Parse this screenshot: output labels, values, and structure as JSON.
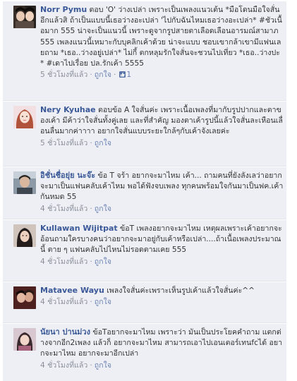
{
  "comments": [
    {
      "name": "Norr Pymu",
      "text": "ตอบ 'O' ว่างเปล่า เพราะเป็นเพลงแนวเต้น *มือโดนมือใจสั่นอีกแล้วสิ ถ้าเป็นแบบนี้เธอว่างอะเปล่า 'ไปกับฉันไหมเธอว่างอะเปล่า* #ชัวเนื้อมาก 555 น่าจะเป็นแนวนี้ เพราะดูจากรูปสายตาเลือดเลือนอารมณ์สามาภ 555 เพลงแนวนี้เหมาะกับบุคลิกเค้าด้วย น่าจะแบบ ชอบเขากล้าเขามีแฟนเลยถาม *เธอ..ว่างอยู่เปล่า* ไม่กี้ ตกหลุมรักใจสั่นจะชวนไปเที่ยว *เธอ..ว่างปะ* #เดาไปเรื่อย ปล.รักเค้า 5555",
      "time": "5 ชั่วโมงที่แล้ว",
      "like": "ถูกใจ",
      "like_count": "1",
      "avatar": "avatar-woman-1"
    },
    {
      "name": "Nery Kyuhae",
      "text": "ตอบข้อ A ใจสั่นค่ะ เพราะเนื้อเพลงที่มากับรูปปากและตาของเค้า มีค้าว่าใจสั่นทั้งคู่เลย และที่สำคัญ มองตาเค้ารูปนี้แล้วใจสั่นละเหือนเลื่อนลื่นมากค่าาาา อยากใจสั่นแบบระยะใกล้ๆกับเค้าจังเลยค่ะ",
      "time": "5 ชั่วโมงที่แล้ว",
      "like": "ถูกใจ",
      "avatar": "avatar-woman-2"
    },
    {
      "name": "อิชั่นชื่อยุ่ย นะจ๊ะ",
      "text": "ข้อ T จร้า อยากจะมาไหม เค้า... ถามคนที่ยังลังเลว่าอยากจะมาเป็นแฟนคลับเค้าไหม พอได้ฟังจบเพลง ทุกคนพร้อมใจกันมาเป็นฟค.เค้ากันหมด 55",
      "time": "4 ชั่วโมงที่แล้ว",
      "like": "ถูกใจ",
      "avatar": "avatar-man-1"
    },
    {
      "name": "Kullawan Wijitpat",
      "text": "ข้อT เพลงอยากจะมาไหม เหตุผลเพราะเค้าอยากจะอ้อนถามใครบางคนว่าอยากจะมาอยู่กับเค้าหรือเปล่า....ถ้าเนื้อเพลงประมาณนี้ ตาย ๆ แฟนคลับไปไหนไม่รอดตามเคย 555",
      "time": "4 ชั่วโมงที่แล้ว",
      "like": "ถูกใจ",
      "avatar": "avatar-woman-3"
    },
    {
      "name": "Matavee Wayu",
      "text": "เพลงใจสั่นค่ะเพราะเห็นรูปเค้าแล้วใจสั่นค่ะ^^",
      "time": "4 ชั่วโมงที่แล้ว",
      "like": "ถูกใจ",
      "avatar": "avatar-couple"
    },
    {
      "name": "นัยนา ปานม่วง",
      "text": "ข้อTอยากจะมาไหม เพราะว่า มันเป็นประโยคคำถาม แตกต่างจากอีก2เพลง แล้วก็ อยากจะมาไหม สามารถเอาไปเอนเตอร์เทนfcได้ อยากจะมาไหม อยากจะมาอีกเปล่า",
      "time": "4 ชั่วโมงที่แล้ว",
      "like": "ถูกใจ",
      "avatar": "avatar-woman-4"
    }
  ],
  "separator": "·"
}
